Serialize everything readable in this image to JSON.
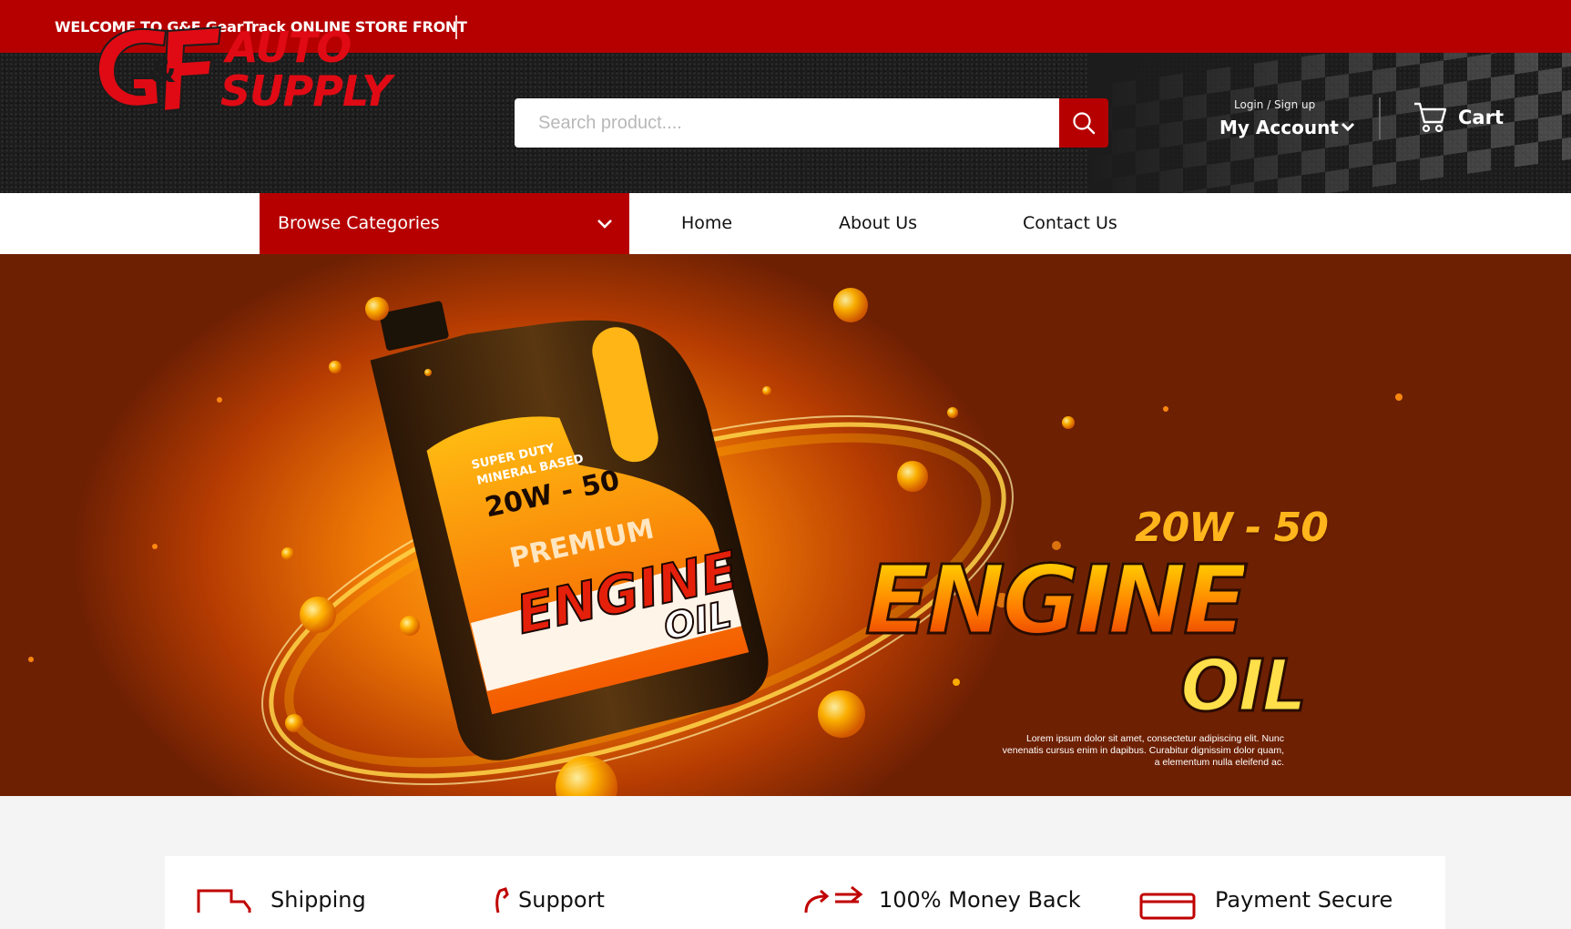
{
  "topbar": {
    "welcome": "WELCOME TO G&F GearTrack ONLINE STORE FRONT"
  },
  "header": {
    "logo": {
      "mark": "G&F",
      "line1": "AUTO",
      "line2": "SUPPLY"
    },
    "search": {
      "placeholder": "Search product...."
    },
    "account": {
      "small": "Login / Sign up",
      "label": "My Account"
    },
    "cart": {
      "label": "Cart"
    }
  },
  "nav": {
    "browse_label": "Browse Categories",
    "links": [
      "Home",
      "About Us",
      "Contact Us"
    ]
  },
  "hero": {
    "jug": {
      "line1": "SUPER DUTY",
      "line2": "MINERAL BASED",
      "grade": "20W - 50",
      "premium": "PREMIUM",
      "engine": "ENGINE",
      "oil": "OIL"
    },
    "grade": "20W - 50",
    "title_engine": "ENGINE",
    "title_oil": "OIL",
    "lorem": [
      "Lorem ipsum dolor sit amet, consectetur adipiscing elit. Nunc",
      "venenatis cursus enim in dapibus. Curabitur dignissim dolor quam,",
      "a elementum nulla eleifend ac."
    ]
  },
  "features": [
    "Shipping",
    "Support",
    "100% Money Back",
    "Payment Secure"
  ],
  "colors": {
    "brand_red": "#b60000",
    "logo_red": "#e00a14",
    "header_dark": "#1c1c1c",
    "hero_orange": "#f07a05"
  }
}
